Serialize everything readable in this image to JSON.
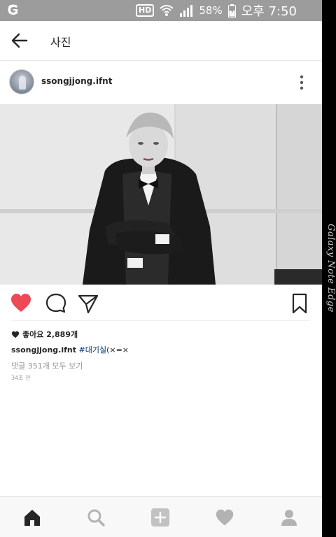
{
  "status_bar": {
    "hd": "HD",
    "battery": "58%",
    "time": "오후 7:50",
    "icons": [
      "app-notification-icon",
      "hd-icon",
      "wifi-icon",
      "signal-icon",
      "battery-icon"
    ]
  },
  "edge_panel": {
    "label": "Galaxy Note Edge"
  },
  "app_bar": {
    "title": "사진",
    "icons": [
      "back-arrow-icon"
    ]
  },
  "post": {
    "username": "ssongjjong.ifnt",
    "likes": "좋아요 2,889개",
    "caption_user": "ssongjjong.ifnt",
    "caption_tag": "#대기실",
    "caption_rest": "(×=×",
    "comments_link": "댓글 351개 모두 보기",
    "time_ago": "34초 전",
    "liked": true,
    "icons": [
      "more-icon",
      "heart-icon",
      "comment-icon",
      "share-icon",
      "bookmark-icon",
      "small-heart-icon"
    ]
  },
  "bottom_nav": {
    "icons": [
      "home-icon",
      "search-icon",
      "add-icon",
      "activity-heart-icon",
      "profile-icon"
    ],
    "active": "home-icon"
  },
  "colors": {
    "like_red": "#ed4956",
    "tag_blue": "#003569",
    "status_bar_gray": "#9c9c9c",
    "edge_black": "#000000"
  }
}
